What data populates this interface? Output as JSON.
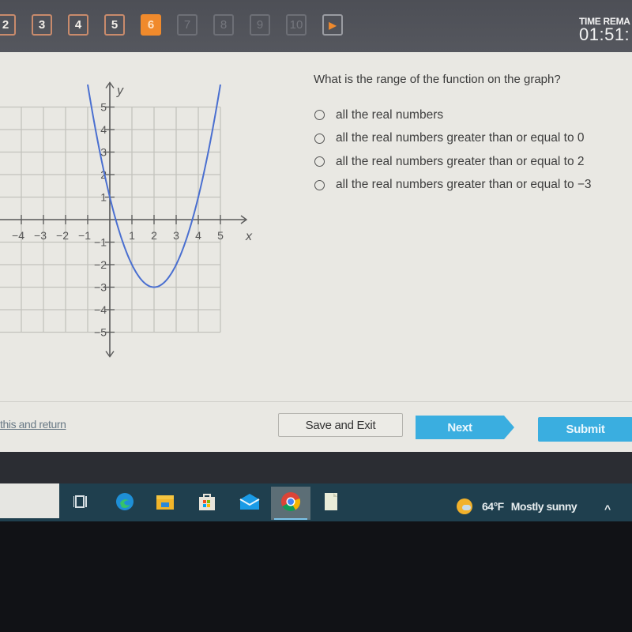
{
  "topbar": {
    "questions": [
      {
        "label": "2",
        "state": "answered"
      },
      {
        "label": "3",
        "state": "answered"
      },
      {
        "label": "4",
        "state": "answered"
      },
      {
        "label": "5",
        "state": "answered"
      },
      {
        "label": "6",
        "state": "current"
      },
      {
        "label": "7",
        "state": "locked"
      },
      {
        "label": "8",
        "state": "locked"
      },
      {
        "label": "9",
        "state": "locked"
      },
      {
        "label": "10",
        "state": "locked"
      }
    ],
    "next_arrow_icon": "play-arrow-icon",
    "timer_label": "TIME REMA",
    "timer_value": "01:51:"
  },
  "question": {
    "text": "What is the range of the function on the graph?",
    "choices": [
      "all the real numbers",
      "all the real numbers greater than or equal to 0",
      "all the real numbers greater than or equal to 2",
      "all the real numbers greater than or equal to −3"
    ]
  },
  "graph": {
    "x_label": "x",
    "y_label": "y",
    "x_ticks": [
      "5",
      "−4",
      "−3",
      "−2",
      "−1",
      "1",
      "2",
      "3",
      "4",
      "5"
    ],
    "y_ticks": [
      "5",
      "4",
      "3",
      "2",
      "1",
      "−1",
      "−2",
      "−3",
      "−4",
      "−5"
    ],
    "function": "y = (x - 2)^2 - 3",
    "vertex": [
      2,
      -3
    ],
    "x_range": [
      -5,
      5
    ],
    "y_range": [
      -5,
      5
    ],
    "curve_color": "#4a6fd0"
  },
  "footer": {
    "link_text": "this and return",
    "save_label": "Save and Exit",
    "next_label": "Next",
    "submit_label": "Submit"
  },
  "taskbar": {
    "icons": [
      "task-view-icon",
      "edge-icon",
      "file-explorer-icon",
      "store-icon",
      "mail-icon",
      "chrome-icon",
      "notepad-icon"
    ],
    "active_icon": "chrome-icon",
    "weather_temp": "64°F",
    "weather_text": "Mostly sunny",
    "tray_chevron": "^"
  },
  "colors": {
    "accent_orange": "#f08a2c",
    "button_blue": "#3aaee0",
    "curve_blue": "#4a6fd0"
  }
}
